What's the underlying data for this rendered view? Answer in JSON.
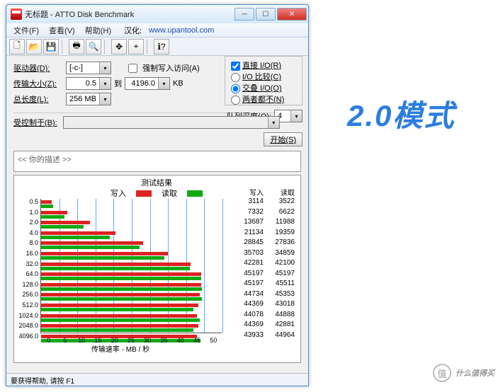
{
  "window": {
    "title": "无标题 - ATTO Disk Benchmark"
  },
  "menu": {
    "file": "文件(F)",
    "view": "查看(V)",
    "help": "帮助(H)",
    "localize_label": "汉化:",
    "localize_url": "www.upantool.com"
  },
  "config": {
    "drive_label": "驱动器(D):",
    "drive_value": "[-c-]",
    "xfer_label": "传输大小(Z):",
    "xfer_value": "0.5",
    "to": "到",
    "xfer_max": "4196.0",
    "kb": "KB",
    "len_label": "总长度(L):",
    "len_value": "256 MB",
    "force_write": "强制写入访问(A)",
    "direct_io": "直接 I/O(R)",
    "io_compare": "I/O 比较(C)",
    "io_overlap": "交叠 I/O(O)",
    "io_neither": "两者都不(N)",
    "queue_label": "队列深度(Q):",
    "queue_value": "4",
    "controlled_label": "受控制于(B):",
    "start": "开始(S)"
  },
  "desc": "<< 你的描述 >>",
  "results": {
    "title": "测试结果",
    "write": "写入",
    "read": "读取",
    "xaxis": "传输速率 - MB / 秒"
  },
  "chart_data": {
    "type": "bar",
    "orientation": "horizontal",
    "x_max": 50,
    "xlabel": "传输速率 - MB / 秒",
    "xticks": [
      0,
      5,
      10,
      15,
      20,
      25,
      30,
      35,
      40,
      45,
      50
    ],
    "categories": [
      "0.5",
      "1.0",
      "2.0",
      "4.0",
      "8.0",
      "16.0",
      "32.0",
      "64.0",
      "128.0",
      "256.0",
      "512.0",
      "1024.0",
      "2048.0",
      "4096.0"
    ],
    "series": [
      {
        "name": "写入",
        "color": "#d22",
        "values_kb": [
          3114,
          7332,
          13687,
          21134,
          28845,
          35703,
          42281,
          45197,
          45197,
          44734,
          44369,
          44078,
          44369,
          43933
        ],
        "values_mb": [
          3.0,
          7.2,
          13.4,
          20.6,
          28.2,
          34.9,
          41.3,
          44.1,
          44.1,
          43.7,
          43.3,
          43.0,
          43.3,
          42.9
        ]
      },
      {
        "name": "读取",
        "color": "#1a1",
        "values_kb": [
          3522,
          6622,
          11988,
          19359,
          27836,
          34859,
          42100,
          45197,
          45511,
          45353,
          43018,
          44888,
          42881,
          44964
        ],
        "values_mb": [
          3.4,
          6.5,
          11.7,
          18.9,
          27.2,
          34.0,
          41.1,
          44.1,
          44.4,
          44.3,
          42.0,
          43.8,
          41.9,
          43.9
        ]
      }
    ]
  },
  "status": "要获得帮助, 请按 F1",
  "mode_label": "2.0模式",
  "watermark": {
    "icon": "值",
    "text": "什么值得买"
  }
}
